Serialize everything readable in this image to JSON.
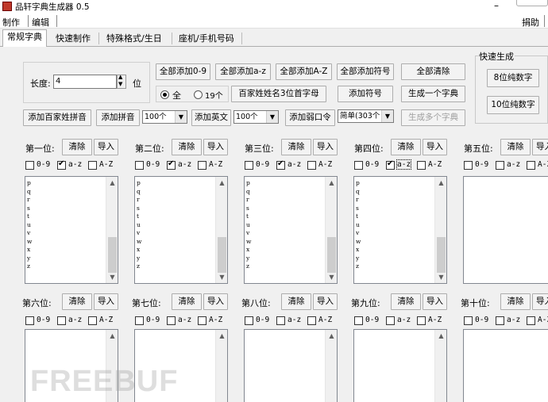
{
  "window": {
    "title": "品轩字典生成器 0.5",
    "minimize_glyph": "–"
  },
  "menu": {
    "items": [
      "制作",
      "编辑"
    ],
    "donate": "捐助"
  },
  "tabs": [
    "常规字典",
    "快速制作",
    "特殊格式/生日",
    "座机/手机号码"
  ],
  "controls": {
    "length_label": "长度:",
    "length_value": "4",
    "length_unit": "位",
    "add_all_09": "全部添加0-9",
    "add_all_az": "全部添加a-z",
    "add_all_AZ": "全部添加A-Z",
    "add_all_symbols": "全部添加符号",
    "clear_all": "全部清除",
    "radio_all": "全",
    "radio_19": "19个",
    "surname_initials": "百家姓姓名3位首字母",
    "add_symbols": "添加符号",
    "gen_one_dict": "生成一个字典",
    "add_surname_pinyin": "添加百家姓拼音",
    "add_pinyin": "添加拼音",
    "pinyin_count": "100个",
    "add_english": "添加英文",
    "english_count": "100个",
    "add_weak_pwd": "添加弱口令",
    "weak_pwd_option": "简单(303个",
    "gen_multi_dict": "生成多个字典"
  },
  "quick_gen": {
    "title": "快速生成",
    "digits8": "8位纯数字",
    "digits10": "10位纯数字"
  },
  "positions": {
    "clear": "清除",
    "import": "导入",
    "opt_09": "0-9",
    "opt_az": "a-z",
    "opt_AZ": "A-Z",
    "labels": [
      "第一位:",
      "第二位:",
      "第三位:",
      "第四位:",
      "第五位:",
      "第六位:",
      "第七位:",
      "第八位:",
      "第九位:",
      "第十位:"
    ],
    "list_items": [
      "p",
      "q",
      "r",
      "s",
      "t",
      "u",
      "v",
      "w",
      "x",
      "y",
      "z"
    ]
  },
  "watermark": "FREEBUF",
  "colors": {
    "background": "#f0f0f0",
    "titlebar_icon": "#c0392b"
  }
}
